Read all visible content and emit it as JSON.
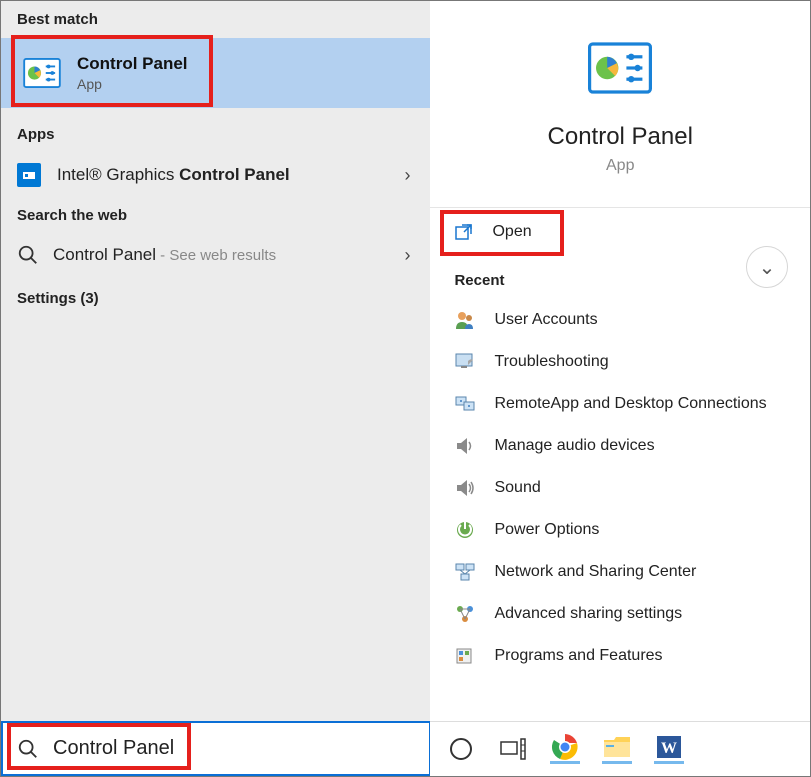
{
  "left": {
    "best_match_header": "Best match",
    "best_match": {
      "title": "Control Panel",
      "subtitle": "App"
    },
    "apps_header": "Apps",
    "apps_row": {
      "prefix": "Intel® Graphics ",
      "bold": "Control Panel"
    },
    "web_header": "Search the web",
    "web_row": {
      "title": "Control Panel",
      "suffix": " - See web results"
    },
    "settings_header": "Settings (3)",
    "search_value": "Control Panel"
  },
  "right": {
    "preview_title": "Control Panel",
    "preview_sub": "App",
    "open_label": "Open",
    "recent_header": "Recent",
    "recent": [
      "User Accounts",
      "Troubleshooting",
      "RemoteApp and Desktop Connections",
      "Manage audio devices",
      "Sound",
      "Power Options",
      "Network and Sharing Center",
      "Advanced sharing settings",
      "Programs and Features"
    ]
  }
}
